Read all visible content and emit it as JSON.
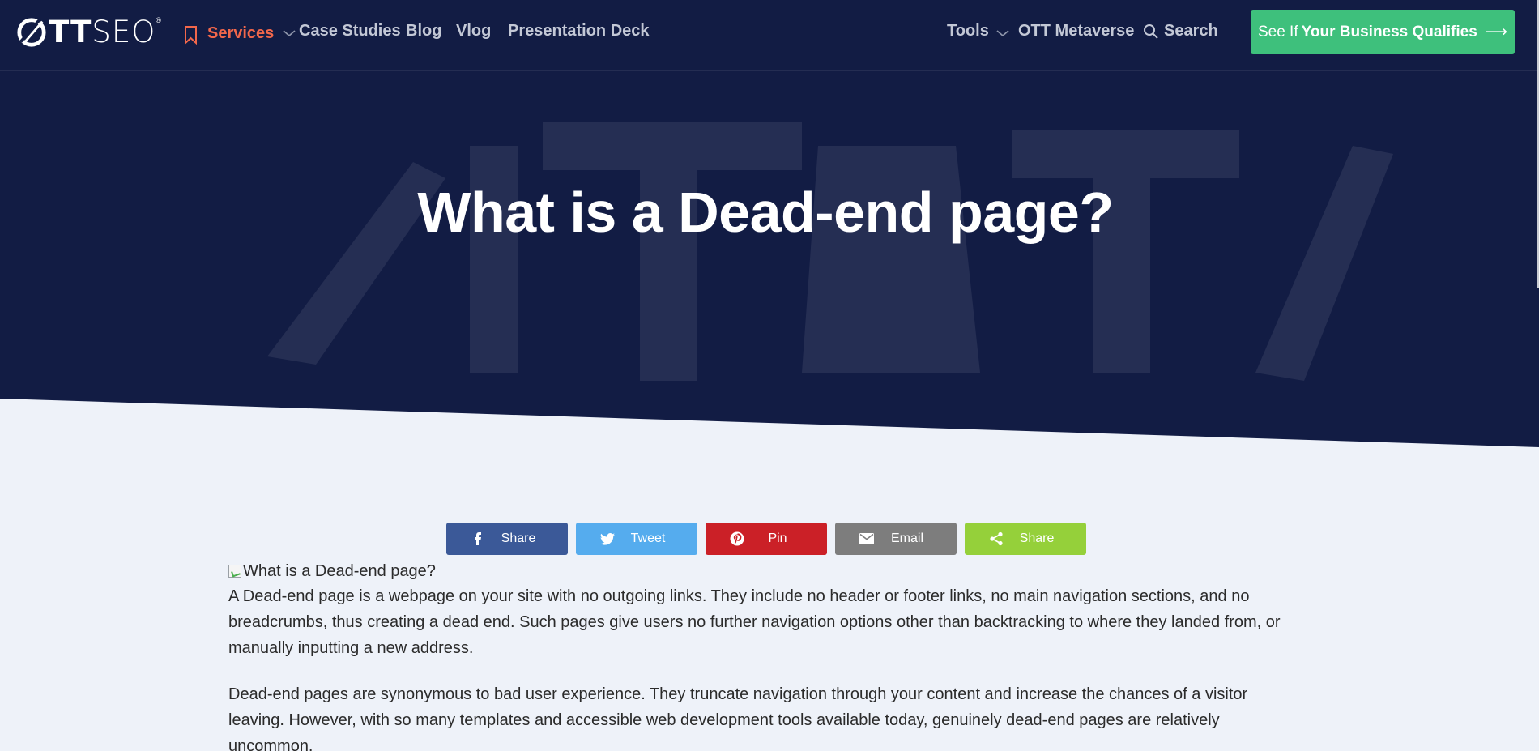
{
  "brand": {
    "logo_text_bold": "TT",
    "logo_text_light": "SEO",
    "registered": "®"
  },
  "nav": {
    "services": "Services",
    "case_studies": "Case Studies",
    "blog": "Blog",
    "vlog": "Vlog",
    "presentation_deck": "Presentation Deck",
    "tools": "Tools",
    "ott_metaverse": "OTT Metaverse",
    "search": "Search"
  },
  "cta": {
    "prefix": "See If",
    "bold": "Your Business Qualifies",
    "arrow": "⟶"
  },
  "hero": {
    "title": "What is a Dead-end page?"
  },
  "share": [
    {
      "label": "Share",
      "icon": "facebook-icon",
      "color": "#3b5998"
    },
    {
      "label": "Tweet",
      "icon": "twitter-icon",
      "color": "#55acee"
    },
    {
      "label": "Pin",
      "icon": "pinterest-icon",
      "color": "#cb2027"
    },
    {
      "label": "Email",
      "icon": "email-icon",
      "color": "#7d7d7d"
    },
    {
      "label": "Share",
      "icon": "share-icon",
      "color": "#95d03a"
    }
  ],
  "article": {
    "image_alt": "What is a Dead-end page?",
    "paragraphs": [
      "A Dead-end page is a webpage on your site with no outgoing links. They include no header or footer links, no main navigation sections, and no breadcrumbs, thus creating a dead end. Such pages give users no further navigation options other than backtracking to where they landed from, or manually inputting a new address.",
      "Dead-end pages are synonymous to bad user experience. They truncate navigation through your content and increase the chances of a visitor leaving. However, with so many templates and accessible web development tools available today, genuinely dead-end pages are relatively uncommon."
    ]
  },
  "colors": {
    "hero_bg": "#121c44",
    "accent_active": "#f2674b",
    "cta": "#3ec07c",
    "page_bg": "#eef2f9"
  }
}
